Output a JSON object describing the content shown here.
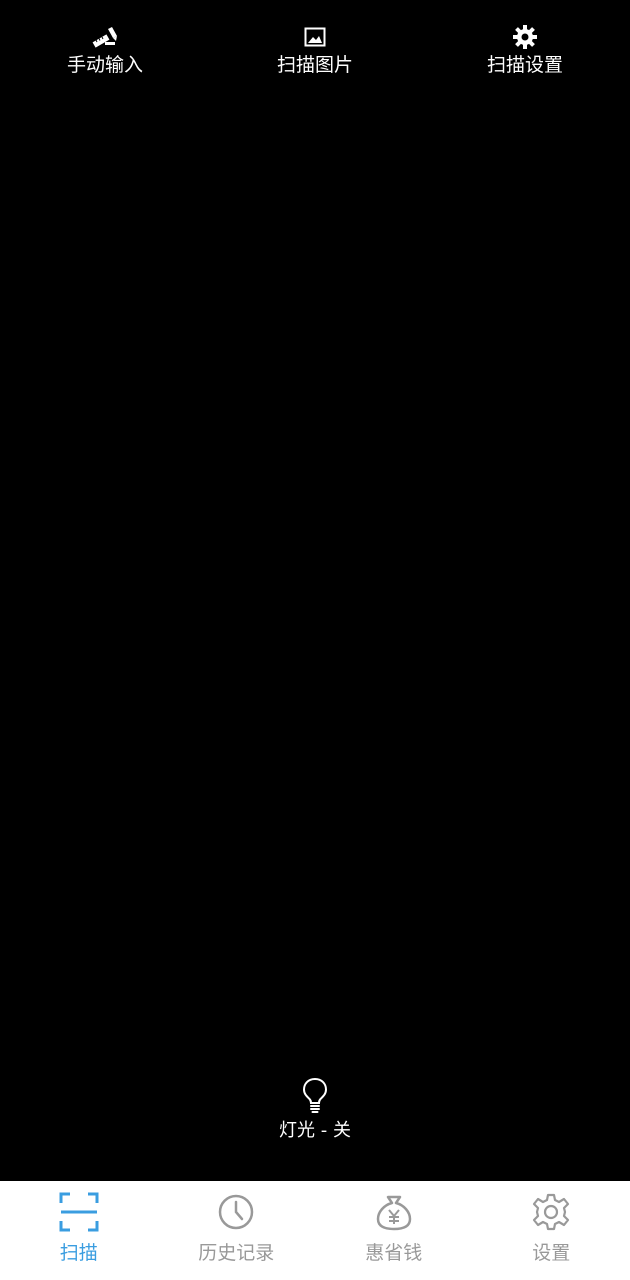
{
  "top_bar": {
    "manual_input": {
      "label": "手动输入",
      "icon": "pencil-ruler-icon"
    },
    "scan_image": {
      "label": "扫描图片",
      "icon": "image-icon"
    },
    "scan_settings": {
      "label": "扫描设置",
      "icon": "gear-icon"
    }
  },
  "flashlight": {
    "label": "灯光 - 关",
    "icon": "lightbulb-icon"
  },
  "bottom_nav": {
    "active_color": "#3a9de0",
    "inactive_color": "#999999",
    "items": [
      {
        "label": "扫描",
        "icon": "scan-frame-icon",
        "active": true
      },
      {
        "label": "历史记录",
        "icon": "clock-icon",
        "active": false
      },
      {
        "label": "惠省钱",
        "icon": "money-bag-icon",
        "active": false
      },
      {
        "label": "设置",
        "icon": "gear-icon",
        "active": false
      }
    ]
  }
}
